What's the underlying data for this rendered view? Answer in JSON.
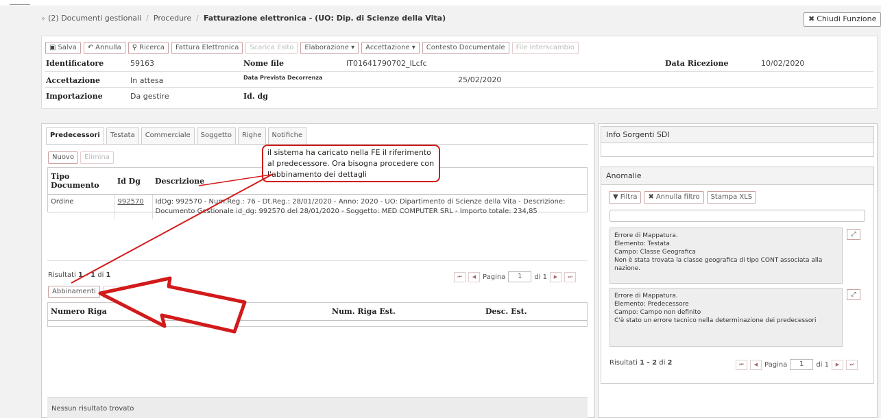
{
  "breadcrumb": {
    "items": [
      "(2) Documenti gestionali",
      "Procedure"
    ],
    "current": "Fatturazione elettronica - (UO: Dip. di Scienze della Vita)"
  },
  "close_button": "Chiudi Funzione",
  "toolbar": {
    "salva": "Salva",
    "annulla": "Annulla",
    "ricerca": "Ricerca",
    "fattura": "Fattura Elettronica",
    "scarica": "Scarica Esito",
    "elaborazione": "Elaborazione",
    "accettazione": "Accettazione",
    "contesto": "Contesto Documentale",
    "file_interscambio": "File Interscambio"
  },
  "header_fields": {
    "identificatore_label": "Identificatore",
    "identificatore_value": "59163",
    "nome_file_label": "Nome file",
    "nome_file_value": "IT01641790702_lLcfc",
    "data_ricezione_label": "Data Ricezione",
    "data_ricezione_value": "10/02/2020",
    "accettazione_label": "Accettazione",
    "accettazione_value": "In attesa",
    "data_prevista_label": "Data Prevista Decorrenza",
    "data_prevista_value": "25/02/2020",
    "importazione_label": "Importazione",
    "importazione_value": "Da gestire",
    "id_dg_label": "Id. dg"
  },
  "tabs": [
    "Predecessori",
    "Testata",
    "Commerciale",
    "Soggetto",
    "Righe",
    "Notifiche"
  ],
  "predecessori": {
    "nuovo": "Nuovo",
    "elimina": "Elimina",
    "columns": [
      "Tipo Documento",
      "Id Dg",
      "Descrizione"
    ],
    "row": {
      "tipo": "Ordine",
      "id": "992570",
      "desc_line1": "IdDg: 992570 - Num.Reg.: 76 - Dt.Reg.: 28/01/2020 - Anno: 2020 - UO: Dipartimento di Scienze della Vita - Descrizione:",
      "desc_line2": "Documento Gestionale id_dg: 992570 del 28/01/2020 - Soggetto: MED COMPUTER SRL - Importo totale: 234,85"
    },
    "results_prefix": "Risultati",
    "results_range": "1 - 1",
    "results_of": "di",
    "results_total": "1",
    "page_label": "Pagina",
    "page_value": "1",
    "page_of": "di 1"
  },
  "abbinamenti": {
    "button": "Abbinamenti",
    "columns": [
      "Numero Riga",
      "Desc. Riga F",
      "Num. Riga Est.",
      "Desc. Est."
    ],
    "empty": "Nessun risultato trovato"
  },
  "callout": {
    "line1": "il sistema ha caricato nella FE il riferimento",
    "line2": "al predecessore. Ora bisogna procedere con",
    "line3": "l'abbinamento dei dettagli"
  },
  "info_sdi": {
    "title": "Info Sorgenti SDI"
  },
  "anomalie": {
    "title": "Anomalie",
    "filtra": "Filtra",
    "annulla_filtro": "Annulla filtro",
    "stampa": "Stampa XLS",
    "items": [
      {
        "line1": "Errore di Mappatura.",
        "line2": "Elemento: Testata",
        "line3": "Campo: Classe Geografica",
        "line4": "Non è stata trovata la classe geografica di tipo CONT associata alla",
        "line5": "nazione."
      },
      {
        "line1": "Errore di Mappatura.",
        "line2": "Elemento: Predecessore",
        "line3": "Campo: Campo non definito",
        "line4": "C'è stato un errore tecnico nella determinazione dei predecessori"
      }
    ],
    "results_prefix": "Risultati",
    "results_range": "1 - 2",
    "results_of": "di",
    "results_total": "2",
    "page_label": "Pagina",
    "page_value": "1",
    "page_of": "di 1"
  },
  "colors": {
    "annotation_red": "#d21a1a",
    "button_border": "#c9a2a2"
  }
}
